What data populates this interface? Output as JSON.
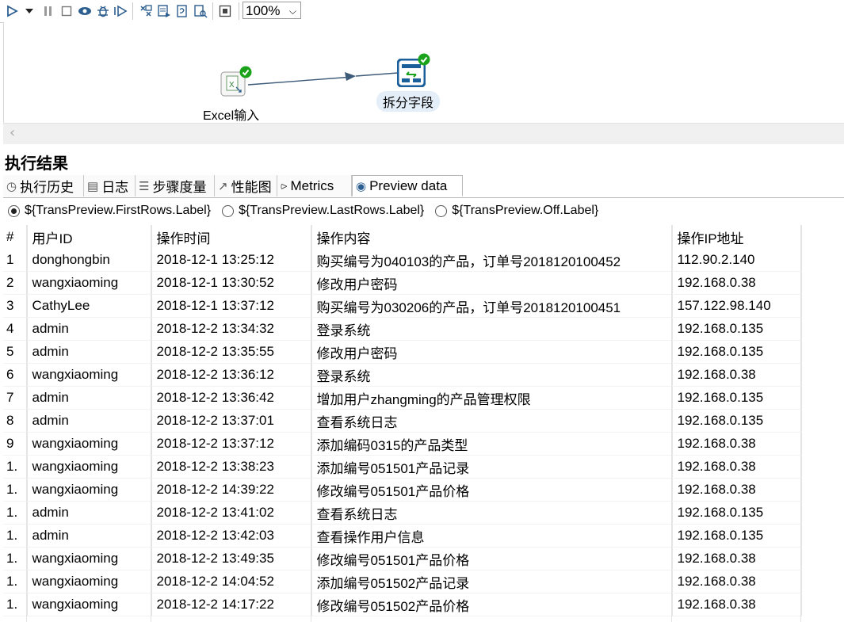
{
  "toolbar": {
    "zoom_value": "100%",
    "icons": [
      "run-icon",
      "run-options-icon",
      "pause-icon",
      "stop-icon",
      "preview-icon",
      "debug-icon",
      "replay-icon",
      "verify-icon",
      "impact-icon",
      "sql-icon",
      "explore-db-icon",
      "show-results-icon"
    ]
  },
  "canvas": {
    "steps": [
      {
        "label": "Excel输入",
        "icon": "excel-input-icon",
        "status": "ok"
      },
      {
        "label": "拆分字段",
        "icon": "split-fields-icon",
        "status": "ok"
      }
    ]
  },
  "results": {
    "title": "执行结果",
    "tabs": [
      {
        "label": "执行历史",
        "icon": "history-icon"
      },
      {
        "label": "日志",
        "icon": "log-icon"
      },
      {
        "label": "步骤度量",
        "icon": "step-metrics-icon"
      },
      {
        "label": "性能图",
        "icon": "performance-icon"
      },
      {
        "label": "Metrics",
        "icon": "metrics-icon"
      },
      {
        "label": "Preview data",
        "icon": "preview-data-icon"
      }
    ],
    "radios": [
      {
        "label": "${TransPreview.FirstRows.Label}",
        "selected": true
      },
      {
        "label": "${TransPreview.LastRows.Label}",
        "selected": false
      },
      {
        "label": "${TransPreview.Off.Label}",
        "selected": false
      }
    ],
    "table": {
      "headers": [
        "#",
        "用户ID",
        "操作时间",
        "操作内容",
        "操作IP地址"
      ],
      "rows": [
        [
          "1",
          "donghongbin",
          "2018-12-1 13:25:12",
          "购买编号为040103的产品，订单号2018120100452",
          "112.90.2.140"
        ],
        [
          "2",
          "wangxiaoming",
          "2018-12-1 13:30:52",
          "修改用户密码",
          "192.168.0.38"
        ],
        [
          "3",
          "CathyLee",
          "2018-12-1 13:37:12",
          "购买编号为030206的产品，订单号2018120100451",
          "157.122.98.140"
        ],
        [
          "4",
          "admin",
          "2018-12-2 13:34:32",
          "登录系统",
          "192.168.0.135"
        ],
        [
          "5",
          "admin",
          "2018-12-2 13:35:55",
          "修改用户密码",
          "192.168.0.135"
        ],
        [
          "6",
          "wangxiaoming",
          "2018-12-2 13:36:12",
          "登录系统",
          "192.168.0.38"
        ],
        [
          "7",
          "admin",
          "2018-12-2 13:36:42",
          "增加用户zhangming的产品管理权限",
          "192.168.0.135"
        ],
        [
          "8",
          "admin",
          "2018-12-2 13:37:01",
          "查看系统日志",
          "192.168.0.135"
        ],
        [
          "9",
          "wangxiaoming",
          "2018-12-2 13:37:12",
          "添加编码0315的产品类型",
          "192.168.0.38"
        ],
        [
          "1.",
          "wangxiaoming",
          "2018-12-2 13:38:23",
          "添加编号051501产品记录",
          "192.168.0.38"
        ],
        [
          "1.",
          "wangxiaoming",
          "2018-12-2 14:39:22",
          "修改编号051501产品价格",
          "192.168.0.38"
        ],
        [
          "1.",
          "admin",
          "2018-12-2 13:41:02",
          "查看系统日志",
          "192.168.0.135"
        ],
        [
          "1.",
          "admin",
          "2018-12-2 13:42:03",
          "查看操作用户信息",
          "192.168.0.135"
        ],
        [
          "1.",
          "wangxiaoming",
          "2018-12-2 13:49:35",
          "修改编号051501产品价格",
          "192.168.0.38"
        ],
        [
          "1.",
          "wangxiaoming",
          "2018-12-2 14:04:52",
          "添加编号051502产品记录",
          "192.168.0.38"
        ],
        [
          "1.",
          "wangxiaoming",
          "2018-12-2 14:17:22",
          "修改编号051502产品价格",
          "192.168.0.38"
        ]
      ]
    }
  },
  "colors": {
    "accent": "#1a5e9a",
    "ok": "#1aa31a"
  }
}
